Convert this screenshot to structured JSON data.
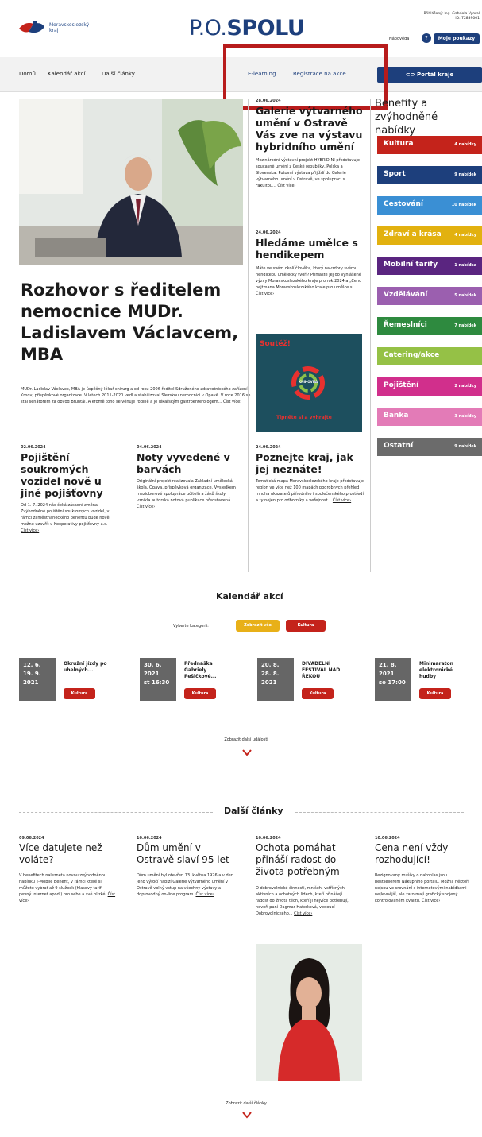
{
  "header": {
    "logo_text_line1": "Moravskoslezský",
    "logo_text_line2": "kraj",
    "title_prefix": "P.O.",
    "title_bold": "SPOLU",
    "user_line1": "Přihlášený: Ing. Gabriela Vyoral",
    "user_line2": "ID: 72839001",
    "help_label": "Nápověda",
    "help_icon": "?",
    "my_offers_button": "Moje poukazy"
  },
  "nav": {
    "home": "Domů",
    "calendar": "Kalendář akcí",
    "articles": "Další články",
    "elearning": "E-learning",
    "registration": "Registrace na akce",
    "portal": "Portál kraje"
  },
  "hero": {
    "title": "Rozhovor s ředitelem nemocnice MUDr. Ladislavem Václavcem, MBA",
    "text": "MUDr. Ladislav Václavec, MBA je úspěšný lékař-chirurg a od roku 2006 ředitel Sdruženého zdravotnického zařízení Krnov, příspěvkové organizace. V letech 2011-2020 vedl a stabilizoval Slezskou nemocnici v Opavě. V roce 2016 se stal senátorem za obvod Bruntál. A kromě toho se věnuje rodině a je lékařským gastroenterologem...",
    "more": "Číst více›"
  },
  "col_middle_top": {
    "date": "28.06.2024",
    "title": "Galerie výtvarného umění v Ostravě Vás zve na výstavu hybridního umění",
    "text": "Mezinárodní výstavní projekt HYBRID-NI představuje současné umění z České republiky, Polska a Slovenska. Putovní výstava přijíždí do Galerie výtvarného umění v Ostravě, ve spolupráci s Fakultou...",
    "more": "Číst více›"
  },
  "col_middle_2": {
    "date": "24.06.2024",
    "title": "Hledáme umělce s hendikepem",
    "text": "Máte ve svém okolí člověka, který navzdory svému hendikepu umělecky tvoří? Přihlaste jej do vyhlášené výzvy Moravskoslezského kraje pro rok 2024 a „Cenu hejtmana Moravskoslezského kraje pro umělce s...",
    "more": "Číst více›"
  },
  "contest": {
    "title": "Soutěž!",
    "brand": "KNIHOVNA",
    "subtitle": "Tipněte si a vyhrajte"
  },
  "small_articles": [
    {
      "date": "02.06.2024",
      "title": "Pojištění soukromých vozidel nově u jiné pojišťovny",
      "text": "Od 1. 7. 2024 nás čeká zásadní změna. Zvýhodněné pojištění soukromých vozidel, v rámci zaměstnaneckého benefitu bude nově možné uzavřít u Kooperativy pojišťovny a.s.",
      "more": "Číst více›"
    },
    {
      "date": "04.06.2024",
      "title": "Noty vyvedené v barvách",
      "text": "Originální projekt realizovala Základní umělecká škola, Opava, příspěvková organizace. Výsledkem mezioborové spolupráce učitelů a žáků školy vznikla autorská notová publikace představená...",
      "more": "Číst více›"
    },
    {
      "date": "24.06.2024",
      "title": "Poznejte kraj, jak jej neznáte!",
      "text": "Tematická mapa Moravskoslezského kraje představuje region ve více než 100 mapách podrobných přehled mnoha ukazatelů přírodního i společenského prostředí a ty nejen pro odborníky a veřejnost...",
      "more": "Číst více›"
    }
  ],
  "benefits": {
    "title": "Benefity a zvýhodněné nabídky",
    "items": [
      {
        "label": "Kultura",
        "count": "4 nabídky",
        "color": "#c4231b"
      },
      {
        "label": "Sport",
        "count": "9 nabídek",
        "color": "#1d3f7c"
      },
      {
        "label": "Cestování",
        "count": "10 nabídek",
        "color": "#3a8fd4"
      },
      {
        "label": "Zdraví a krása",
        "count": "4 nabídky",
        "color": "#e2b10f"
      },
      {
        "label": "Mobilní tarify",
        "count": "1 nabídka",
        "color": "#5a2580"
      },
      {
        "label": "Vzdělávání",
        "count": "5 nabídek",
        "color": "#9b5faf"
      },
      {
        "label": "Řemeslníci",
        "count": "7 nabídek",
        "color": "#2e8a3f"
      },
      {
        "label": "Catering/akce",
        "count": "",
        "color": "#95c146"
      },
      {
        "label": "Pojištění",
        "count": "2 nabídky",
        "color": "#d12f8c"
      },
      {
        "label": "Banka",
        "count": "3 nabídky",
        "color": "#e37bb7"
      },
      {
        "label": "Ostatní",
        "count": "9 nabídek",
        "color": "#6b6b6b"
      }
    ]
  },
  "calendar": {
    "title": "Kalendář akcí",
    "category_label": "Vyberte kategorii:",
    "show_all": "Zobrazit vše",
    "culture": "Kultura",
    "events": [
      {
        "d1": "12. 6.",
        "d2": "19. 9.",
        "d3": "2021",
        "title": "Okružní jízdy po uhelných...",
        "tag": "Kultura"
      },
      {
        "d1": "30. 6.",
        "d2": "2021",
        "d3": "st 16:30",
        "title": "Přednáška Gabriely Pešičkové...",
        "tag": "Kultura"
      },
      {
        "d1": "20. 8.",
        "d2": "28. 8.",
        "d3": "2021",
        "title": "DIVADELNÍ FESTIVAL NAD ŘEKOU",
        "tag": "Kultura"
      },
      {
        "d1": "21. 8.",
        "d2": "2021",
        "d3": "so 17:00",
        "title": "Minimaraton elektronické hudby",
        "tag": "Kultura"
      }
    ],
    "show_more": "Zobrazit další události"
  },
  "further": {
    "title": "Další články",
    "articles": [
      {
        "date": "09.06.2024",
        "title": "Více datujete než voláte?",
        "text": "V benefitech nalezneta novou zvýhodněnou nabídku T-Mobile Benefit, v rámci které si můžete vybrat až 9 službek (hlasový tarif, pevný internet apod.) pro sebe a své blízké.",
        "more": "Číst více›"
      },
      {
        "date": "10.06.2024",
        "title": "Dům umění v Ostravě slaví 95 let",
        "text": "Dům umění byl otevřen 13. května 1926 a v den jeho výročí nabízí Galerie výtvarného umění v Ostravě volný vstup na všechny výstavy a doprovodný on-line program.",
        "more": "Číst více›"
      },
      {
        "date": "10.06.2024",
        "title": "Ochota pomáhat přináší radost do života potřebným",
        "text": "O dobrovolnické činnosti, mnišeh, vstřícných, aktivních a ochotných lidech, kteří přinášejí radost do života těch, kteří ji nejvíce potřebují, hovoří paní Dagmar Haferková, vedoucí Dobrovolnického...",
        "more": "Číst více›"
      },
      {
        "date": "10.06.2024",
        "title": "Cena není vždy rozhodující!",
        "text": "Rezignovaný rozšíky o nakonlas jsou bestsellerem Nákupního portálu. Možná někteří nejsou ve srovnání s internetovými nabídkami nejlevnější, ale zato mají grafický spojený kontrolovaném kvalitu.",
        "more": "Číst více›"
      }
    ],
    "show_more": "Zobrazit další články"
  }
}
